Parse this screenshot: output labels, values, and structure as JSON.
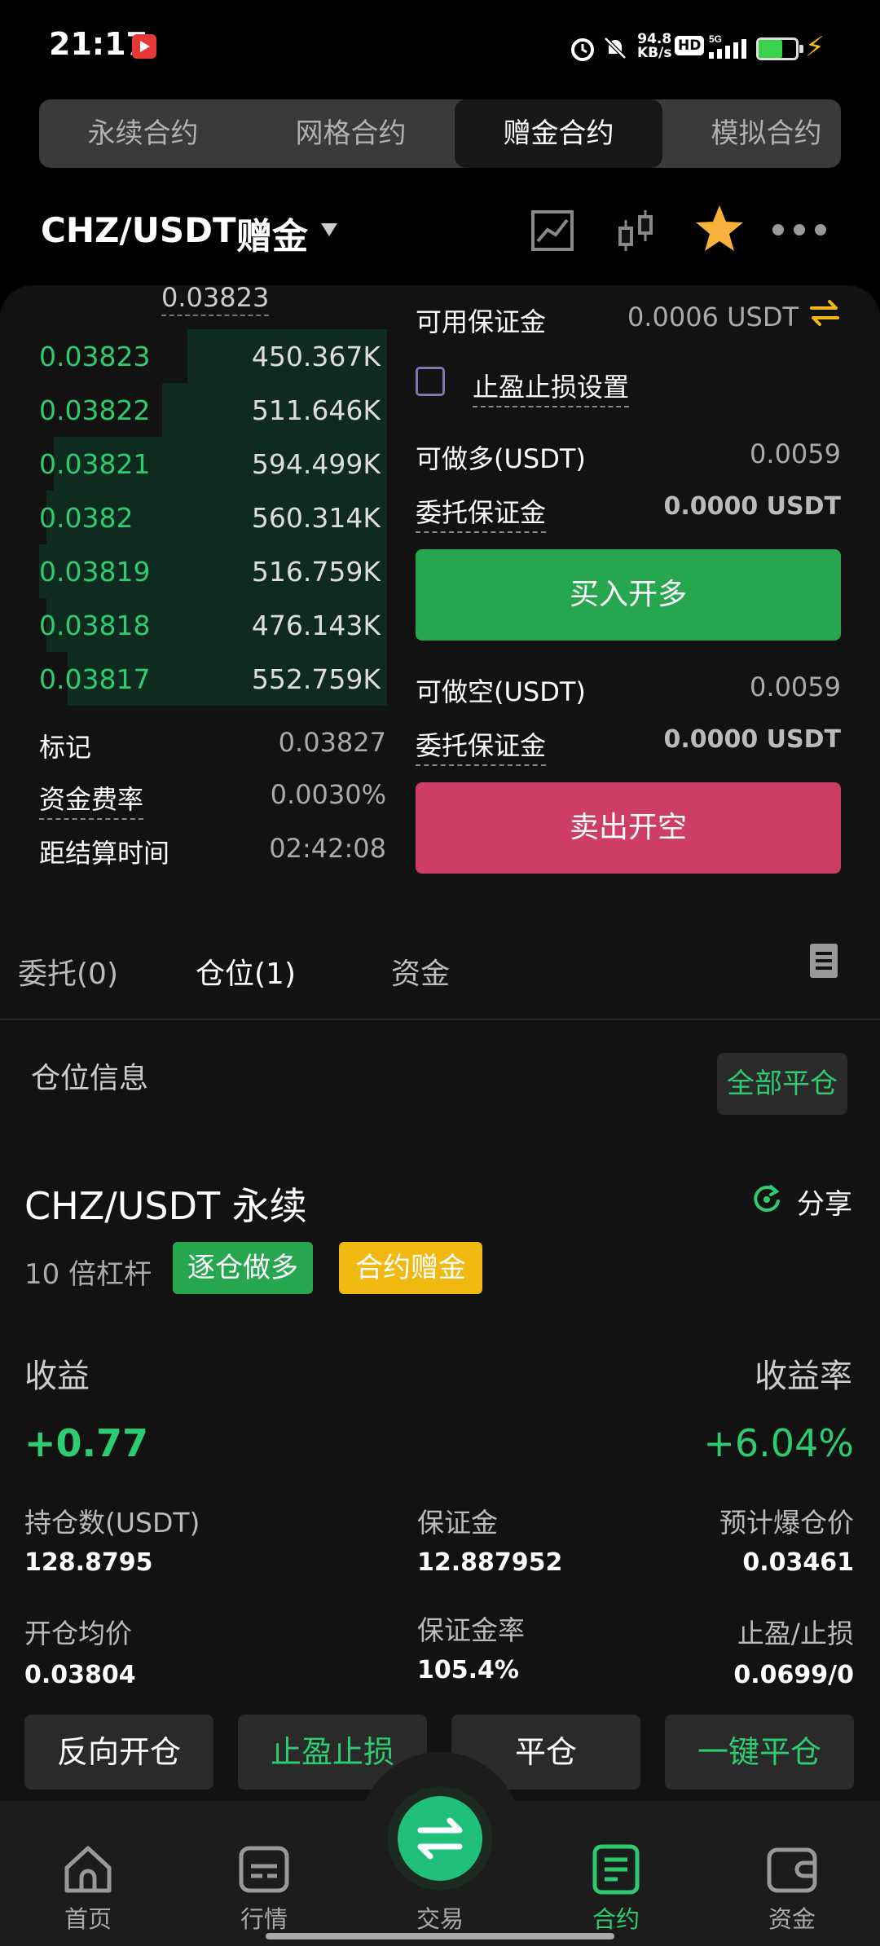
{
  "status_bar": {
    "time": "21:17",
    "net_speed_value": "94.8",
    "net_speed_unit": "KB/s",
    "hd": "HD",
    "network": "5G",
    "battery_level": 0.62
  },
  "contract_tabs": [
    {
      "label": "永续合约",
      "active": false
    },
    {
      "label": "网格合约",
      "active": false
    },
    {
      "label": "赠金合约",
      "active": true
    },
    {
      "label": "模拟合约",
      "active": false
    }
  ],
  "header": {
    "pair": "CHZ/USDT",
    "tag": "赠金"
  },
  "order_book": {
    "top_price": "0.03823",
    "rows": [
      {
        "price": "0.03823",
        "size": "450.367K",
        "depth": 0.55
      },
      {
        "price": "0.03822",
        "size": "511.646K",
        "depth": 0.62
      },
      {
        "price": "0.03821",
        "size": "594.499K",
        "depth": 0.92
      },
      {
        "price": "0.0382",
        "size": "560.314K",
        "depth": 0.94
      },
      {
        "price": "0.03819",
        "size": "516.759K",
        "depth": 0.96
      },
      {
        "price": "0.03818",
        "size": "476.143K",
        "depth": 0.94
      },
      {
        "price": "0.03817",
        "size": "552.759K",
        "depth": 0.88
      }
    ],
    "mark_label": "标记",
    "mark_value": "0.03827",
    "funding_label": "资金费率",
    "funding_value": "0.0030%",
    "settle_label": "距结算时间",
    "settle_value": "02:42:08"
  },
  "trade_panel": {
    "available_label": "可用保证金",
    "available_value": "0.0006 USDT",
    "tpsl_label": "止盈止损设置",
    "long_label": "可做多(USDT)",
    "long_value": "0.0059",
    "long_margin_label": "委托保证金",
    "long_margin_value": "0.0000 USDT",
    "buy_button": "买入开多",
    "short_label": "可做空(USDT)",
    "short_value": "0.0059",
    "short_margin_label": "委托保证金",
    "short_margin_value": "0.0000 USDT",
    "sell_button": "卖出开空"
  },
  "bottom_tabs": [
    {
      "label": "委托(0)",
      "active": false
    },
    {
      "label": "仓位(1)",
      "active": true
    },
    {
      "label": "资金",
      "active": false
    }
  ],
  "position": {
    "section_title": "仓位信息",
    "close_all": "全部平仓",
    "pair": "CHZ/USDT 永续",
    "share": "分享",
    "leverage": "10 倍杠杆",
    "side_badge": "逐仓做多",
    "bonus_badge": "合约赠金",
    "pnl_label": "收益",
    "pnl_value": "+0.77",
    "roe_label": "收益率",
    "roe_value": "+6.04%",
    "stats": [
      {
        "label": "持仓数(USDT)",
        "value": "128.8795"
      },
      {
        "label": "保证金",
        "value": "12.887952"
      },
      {
        "label": "预计爆仓价",
        "value": "0.03461"
      },
      {
        "label": "开仓均价",
        "value": "0.03804"
      },
      {
        "label": "保证金率",
        "value": "105.4%"
      },
      {
        "label": "止盈/止损",
        "value": "0.0699/0"
      }
    ],
    "actions": [
      "反向开仓",
      "止盈止损",
      "平仓",
      "一键平仓"
    ]
  },
  "nav": [
    {
      "label": "首页",
      "icon": "home-icon",
      "active": false
    },
    {
      "label": "行情",
      "icon": "market-icon",
      "active": false
    },
    {
      "label": "交易",
      "icon": "swap-icon",
      "active": false
    },
    {
      "label": "合约",
      "icon": "contract-icon",
      "active": true
    },
    {
      "label": "资金",
      "icon": "wallet-icon",
      "active": false
    }
  ],
  "colors": {
    "green": "#27a650",
    "red": "#cd3d64",
    "accent": "#2ecc71",
    "bonus": "#f1b90f"
  }
}
